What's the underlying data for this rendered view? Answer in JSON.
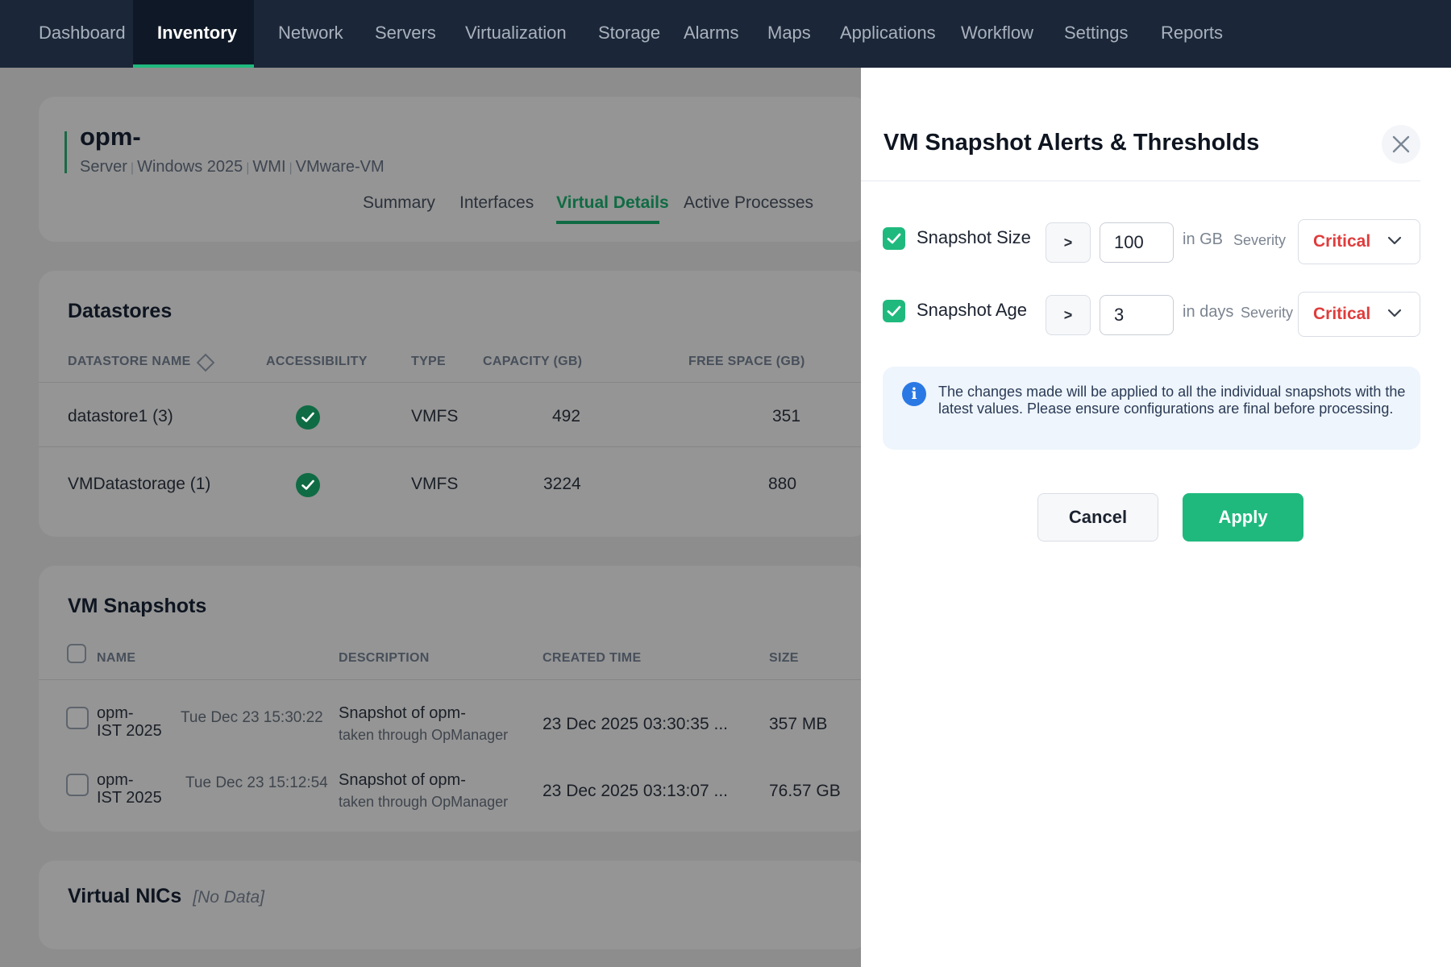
{
  "nav": {
    "items": [
      "Dashboard",
      "Inventory",
      "Network",
      "Servers",
      "Virtualization",
      "Storage",
      "Alarms",
      "Maps",
      "Applications",
      "Workflow",
      "Settings",
      "Reports"
    ],
    "active": "Inventory"
  },
  "device": {
    "name": "opm-",
    "meta": [
      "Server",
      "Windows 2025",
      "WMI",
      "VMware-VM"
    ],
    "tabs": [
      "Summary",
      "Interfaces",
      "Virtual Details",
      "Active Processes"
    ],
    "active_tab": "Virtual Details"
  },
  "datastores": {
    "title": "Datastores",
    "columns": [
      "DATASTORE NAME",
      "ACCESSIBILITY",
      "TYPE",
      "CAPACITY (GB)",
      "FREE SPACE (GB)"
    ],
    "rows": [
      {
        "name": "datastore1 (3)",
        "accessible": true,
        "type": "VMFS",
        "capacity": "492",
        "free": "351"
      },
      {
        "name": "VMDatastorage (1)",
        "accessible": true,
        "type": "VMFS",
        "capacity": "3224",
        "free": "880"
      }
    ]
  },
  "snapshots": {
    "title": "VM Snapshots",
    "columns": [
      "NAME",
      "DESCRIPTION",
      "CREATED TIME",
      "SIZE"
    ],
    "rows": [
      {
        "name_line1": "opm-",
        "name_line2": "IST 2025",
        "name_time": "Tue Dec 23 15:30:22",
        "desc_line1": "Snapshot of opm-",
        "desc_line2": "taken through OpManager",
        "created": "23 Dec 2025 03:30:35 ...",
        "size": "357 MB"
      },
      {
        "name_line1": "opm-",
        "name_line2": "IST 2025",
        "name_time": "Tue Dec 23 15:12:54",
        "desc_line1": "Snapshot of opm-",
        "desc_line2": "taken through OpManager",
        "created": "23 Dec 2025 03:13:07 ...",
        "size": "76.57 GB"
      }
    ]
  },
  "vnics": {
    "title": "Virtual NICs",
    "empty_text": "[No Data]"
  },
  "drawer": {
    "title": "VM Snapshot Alerts & Thresholds",
    "thresholds": [
      {
        "label": "Snapshot Size",
        "checked": true,
        "operator": ">",
        "value": "100",
        "unit": "in GB",
        "severity_label": "Severity",
        "severity": "Critical"
      },
      {
        "label": "Snapshot Age",
        "checked": true,
        "operator": ">",
        "value": "3",
        "unit": "in days",
        "severity_label": "Severity",
        "severity": "Critical"
      }
    ],
    "info": "The changes made will be applied to all the individual snapshots with the latest values. Please ensure configurations are final before processing.",
    "cancel_label": "Cancel",
    "apply_label": "Apply"
  },
  "colors": {
    "nav_bg": "#1b2738",
    "accent_green": "#1fb97e",
    "critical_red": "#e03c3c",
    "info_blue": "#2a78e4"
  }
}
